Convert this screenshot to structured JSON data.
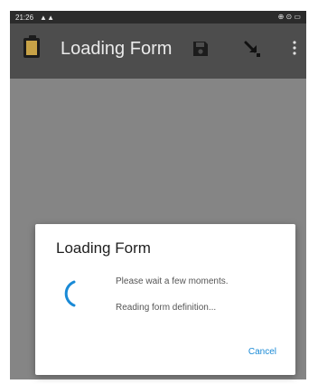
{
  "status_bar": {
    "time": "21:26",
    "signal": "▲ ▲",
    "right_icons": "⊕ ⊙ ▭"
  },
  "app_bar": {
    "title": "Loading Form",
    "icons": [
      "clipboard-icon",
      "save-icon",
      "download-arrow-icon",
      "more-vert-icon"
    ]
  },
  "dialog": {
    "title": "Loading Form",
    "message_1": "Please wait a few moments.",
    "message_2": "Reading form definition...",
    "cancel_label": "Cancel"
  },
  "colors": {
    "app_bar": "#4d4d4d",
    "status_bar": "#2b2b2b",
    "scrim": "#858585",
    "accent": "#1a8ad6"
  }
}
